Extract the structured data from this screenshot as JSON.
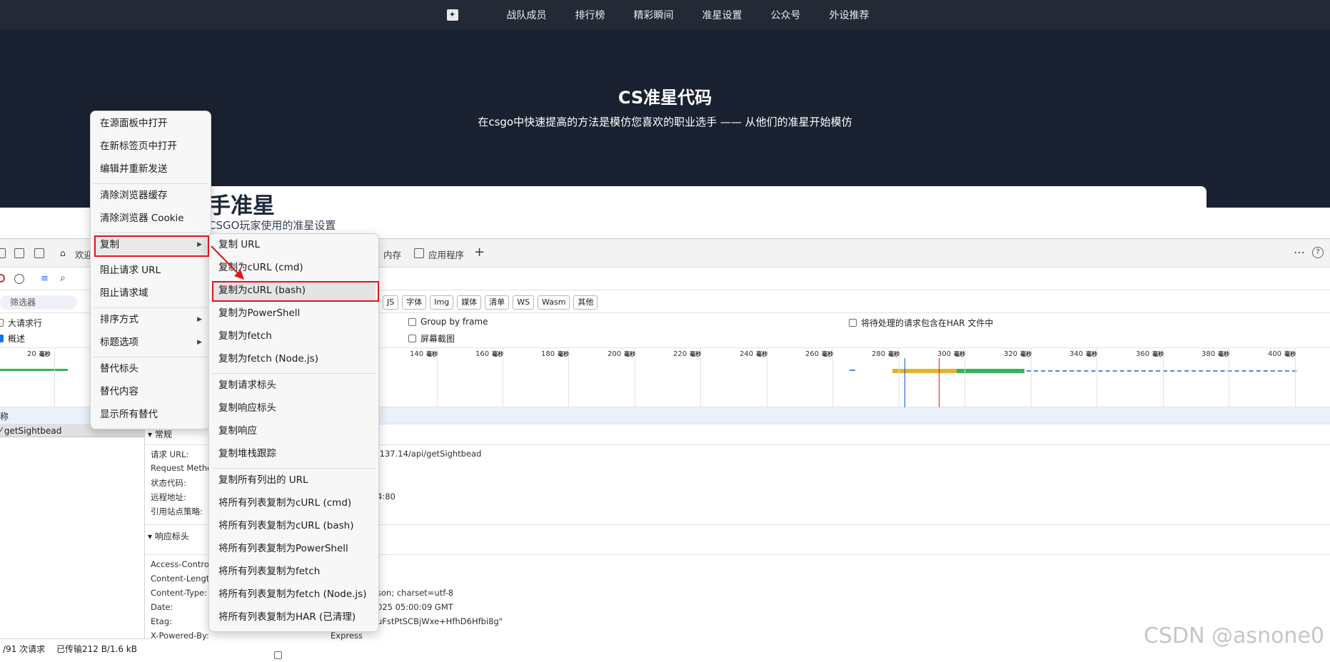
{
  "site": {
    "nav": [
      "战队成员",
      "排行榜",
      "精彩瞬间",
      "准星设置",
      "公众号",
      "外设推荐"
    ],
    "hero_title": "CS准星代码",
    "hero_subtitle": "在csgo中快速提高的方法是模仿您喜欢的职业选手 —— 从他们的准星开始模仿",
    "card_title": "手准星",
    "card_subtitle": "CSGO玩家使用的准星设置"
  },
  "devtools": {
    "tabs": {
      "welcome": "欢迎",
      "memory": "内存",
      "application": "应用程序"
    },
    "filter_placeholder": "筛选器",
    "type_filters": [
      "JS",
      "字体",
      "Img",
      "媒体",
      "清单",
      "WS",
      "Wasm",
      "其他"
    ],
    "options": {
      "large_rows": "大请求行",
      "overview": "概述",
      "group_by_frame": "Group by frame",
      "screenshots": "屏幕截图",
      "har_pending": "将待处理的请求包含在HAR 文件中"
    },
    "timeline_ticks": [
      "20",
      "140",
      "160",
      "180",
      "200",
      "220",
      "240",
      "260",
      "280",
      "300",
      "320",
      "340",
      "360",
      "380",
      "400"
    ],
    "timeline_unit": "毫秒",
    "name_col": "称",
    "request_name": "getSightbead",
    "general_section": "常规",
    "general": [
      {
        "key": "请求 URL:",
        "value": ".137.14/api/getSightbead"
      },
      {
        "key": "Request Metho",
        "value": ""
      },
      {
        "key": "状态代码:",
        "value": ""
      },
      {
        "key": "远程地址:",
        "value": "4:80"
      },
      {
        "key": "引用站点策略:",
        "value": ""
      }
    ],
    "response_section": "响应标头",
    "response_headers": [
      {
        "key": "Access-Control",
        "value": ""
      },
      {
        "key": "Content-Length",
        "value": ""
      },
      {
        "key": "Content-Type:",
        "value": "son; charset=utf-8"
      },
      {
        "key": "Date:",
        "value": "025 05:00:09 GMT"
      },
      {
        "key": "Etag:",
        "value": "uFstPtSCBjWxe+HfhD6Hfbi8g\""
      },
      {
        "key": "X-Powered-By:",
        "value": "Express"
      }
    ],
    "status_requests": "/91 次请求",
    "status_transferred": "已传输212 B/1.6 kB"
  },
  "context_menu": {
    "items": [
      "在源面板中打开",
      "在新标签页中打开",
      "编辑并重新发送",
      "清除浏览器缓存",
      "清除浏览器 Cookie",
      "复制",
      "阻止请求 URL",
      "阻止请求域",
      "排序方式",
      "标题选项",
      "替代标头",
      "替代内容",
      "显示所有替代"
    ]
  },
  "copy_submenu": {
    "items": [
      "复制 URL",
      "复制为cURL (cmd)",
      "复制为cURL (bash)",
      "复制为PowerShell",
      "复制为fetch",
      "复制为fetch (Node.js)",
      "复制请求标头",
      "复制响应标头",
      "复制响应",
      "复制堆栈跟踪",
      "复制所有列出的 URL",
      "将所有列表复制为cURL (cmd)",
      "将所有列表复制为cURL (bash)",
      "将所有列表复制为PowerShell",
      "将所有列表复制为fetch",
      "将所有列表复制为fetch (Node.js)",
      "将所有列表复制为HAR (已清理)"
    ]
  },
  "watermark": "CSDN @asnone0",
  "colors": {
    "nav_bg": "#232a36",
    "hero_bg": "#1a2130",
    "highlight": "#e0151b",
    "timeline_green": "#2fb85a",
    "timeline_orange": "#e5b22b"
  }
}
